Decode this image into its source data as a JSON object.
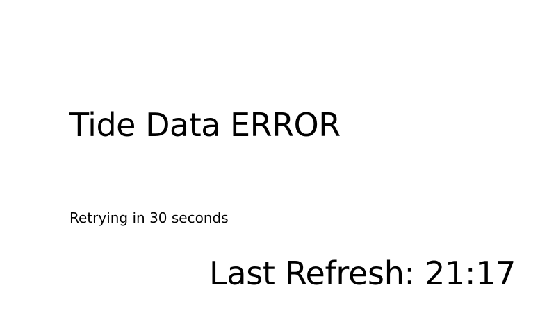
{
  "status": {
    "title": "Tide Data ERROR",
    "message": "Retrying in 30 seconds",
    "last_refresh": "Last Refresh: 21:17"
  },
  "colors": {
    "background": "#ffffff",
    "text": "#000000"
  }
}
